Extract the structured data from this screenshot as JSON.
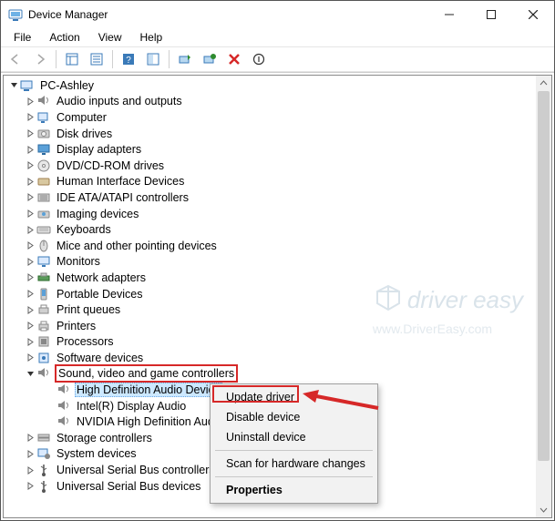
{
  "window": {
    "title": "Device Manager"
  },
  "menus": {
    "file": "File",
    "action": "Action",
    "view": "View",
    "help": "Help"
  },
  "tree": {
    "root": "PC-Ashley",
    "items": [
      "Audio inputs and outputs",
      "Computer",
      "Disk drives",
      "Display adapters",
      "DVD/CD-ROM drives",
      "Human Interface Devices",
      "IDE ATA/ATAPI controllers",
      "Imaging devices",
      "Keyboards",
      "Mice and other pointing devices",
      "Monitors",
      "Network adapters",
      "Portable Devices",
      "Print queues",
      "Printers",
      "Processors",
      "Software devices",
      "Sound, video and game controllers"
    ],
    "sound_children": [
      "High Definition Audio Device",
      "Intel(R) Display Audio",
      "NVIDIA High Definition Audio"
    ],
    "after": [
      "Storage controllers",
      "System devices",
      "Universal Serial Bus controllers",
      "Universal Serial Bus devices"
    ]
  },
  "context_menu": {
    "update": "Update driver",
    "disable": "Disable device",
    "uninstall": "Uninstall device",
    "scan": "Scan for hardware changes",
    "properties": "Properties"
  },
  "watermark": {
    "line1": "driver easy",
    "line2": "www.DriverEasy.com"
  }
}
